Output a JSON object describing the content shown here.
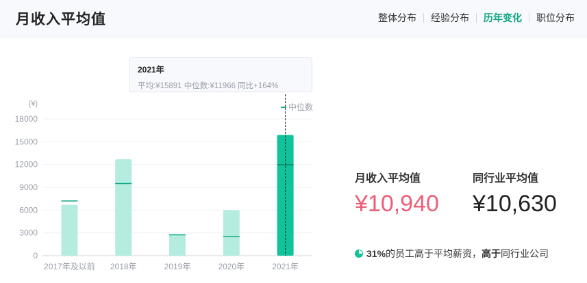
{
  "header": {
    "title": "月收入平均值",
    "tabs": [
      {
        "label": "整体分布",
        "active": false
      },
      {
        "label": "经验分布",
        "active": false
      },
      {
        "label": "历年变化",
        "active": true
      },
      {
        "label": "职位分布",
        "active": false
      }
    ]
  },
  "tooltip": {
    "title": "2021年",
    "detail": "平均:¥15891  中位数:¥11966  同比+164%"
  },
  "stats": {
    "own_label": "月收入平均值",
    "own_value": "¥10,940",
    "industry_label": "同行业平均值",
    "industry_value": "¥10,630"
  },
  "note": {
    "percent": "31%",
    "mid": "的员工高于平均薪资，",
    "emphasis": "高于",
    "tail": "同行业公司"
  },
  "colors": {
    "bar": "#b4ece0",
    "bar_active": "#10c39a",
    "median": "#10a783",
    "accent_red": "#ee5d77"
  },
  "chart_data": {
    "type": "bar",
    "unit_label": "(¥)",
    "legend": "中位数",
    "categories": [
      "2017年及以前",
      "2018年",
      "2019年",
      "2020年",
      "2021年"
    ],
    "series": [
      {
        "values": [
          6700,
          12700,
          2800,
          6000,
          15891
        ]
      },
      {
        "name": "中位数",
        "values": [
          7200,
          9500,
          2750,
          2500,
          11966
        ]
      }
    ],
    "yticks": [
      0,
      3000,
      6000,
      9000,
      12000,
      15000,
      18000
    ],
    "ylim": [
      0,
      18000
    ],
    "highlight_index": 4,
    "grid": true
  }
}
